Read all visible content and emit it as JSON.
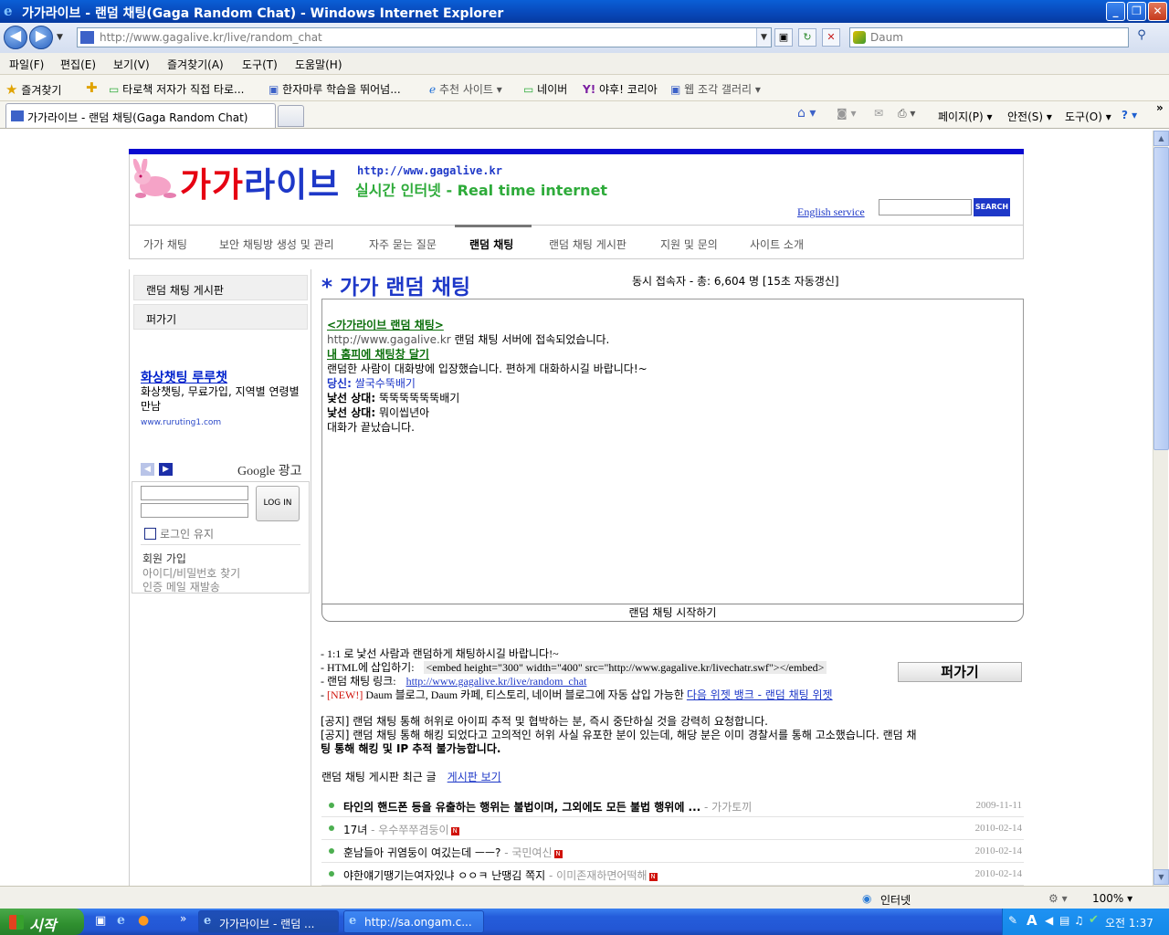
{
  "window": {
    "title": "가가라이브 - 랜덤 채팅(Gaga Random Chat) - Windows Internet Explorer",
    "minimize": "_",
    "maximize": "❐",
    "close": "✕"
  },
  "address": {
    "url": "http://www.gagalive.kr/live/random_chat",
    "search_placeholder": "Daum"
  },
  "menu": [
    "파일(F)",
    "편집(E)",
    "보기(V)",
    "즐겨찾기(A)",
    "도구(T)",
    "도움말(H)"
  ],
  "favorites": {
    "label": "즐겨찾기",
    "items": [
      "타로책 저자가 직접 타로...",
      "한자마루 학습을 뛰어넘...",
      "추천 사이트 ▾",
      "네이버",
      "야후! 코리아",
      "웹 조각 갤러리 ▾"
    ]
  },
  "tab": {
    "label": "가가라이브 - 랜덤 채팅(Gaga Random Chat)"
  },
  "commandbar": [
    "페이지(P) ▾",
    "안전(S) ▾",
    "도구(O) ▾"
  ],
  "header": {
    "logo_red": "가가",
    "logo_blue": "라이브",
    "site_url": "http://www.gagalive.kr",
    "slogan": "실시간 인터넷 - Real time internet",
    "english_service": "English service",
    "search_button": "SEARCH"
  },
  "nav": [
    "가가 채팅",
    "보안 채팅방 생성 및 관리",
    "자주 묻는 질문",
    "랜덤 채팅",
    "랜덤 채팅 게시판",
    "지원 및 문의",
    "사이트 소개"
  ],
  "sidebar": {
    "items": [
      "랜덤 채팅 게시판",
      "퍼가기"
    ],
    "ad": {
      "title": "화상챗팅 루루챗",
      "desc": "화상챗팅, 무료가입, 지역별 연령별 만남",
      "url": "www.ruruting1.com",
      "prev": "◀",
      "next": "▶",
      "google": "Google 광고"
    },
    "login": {
      "button": "LOG IN",
      "keep": "로그인 유지",
      "join": "회원 가입",
      "find": "아이디/비밀번호 찾기",
      "resend": "인증 메일 재발송"
    }
  },
  "main": {
    "title": "* 가가 랜덤 채팅",
    "online": "동시 접속자 - 총: 6,604 명 [15초 자동갱신]",
    "chat": {
      "header_link": "<가가라이브 랜덤 채팅>",
      "connected_url": "http://www.gagalive.kr",
      "connected_text": " 랜덤 채팅 서버에 접속되었습니다.",
      "embed_link": " 내 홈피에 채팅창 달기",
      "entered": "랜덤한 사람이 대화방에 입장했습니다. 편하게 대화하시길 바랍니다!~",
      "you_label": "당신:",
      "you_msg": " 쌀국수뚝배기",
      "stranger_label": "낯선 상대:",
      "stranger_msg1": " 뚝뚝뚝뚝뚝뚝배기",
      "stranger_msg2": " 뭐이씹년아",
      "ended": "대화가 끝났습니다."
    },
    "start_button": "랜덤 채팅 시작하기",
    "info": {
      "line1": "- 1:1 로 낯선 사람과 랜덤하게 채팅하시길 바랍니다!~",
      "line2_label": "- HTML에 삽입하기:",
      "line2_code": "<embed height=\"300\" width=\"400\" src=\"http://www.gagalive.kr/livechatr.swf\"></embed>",
      "line3_label": "- 랜덤 채팅 링크:",
      "line3_link": "http://www.gagalive.kr/live/random_chat",
      "line4_prefix": "- ",
      "line4_new": "[NEW!]",
      "line4_text": " Daum 블로그, Daum 카페, 티스토리, 네이버 블로그에 자동 삽입 가능한 ",
      "line4_link": "다음 위젯 뱅크 - 랜덤 채팅 위젯"
    },
    "scrap_button": "퍼가기",
    "notices": [
      "[공지] 랜덤 채팅 통해 허위로 아이피 추적 및 협박하는 분, 즉시 중단하실 것을 강력히 요청합니다.",
      "[공지] 랜덤 채팅 통해 해킹 되었다고 고의적인 허위 사실 유포한 분이 있는데, 해당 분은 이미 경찰서를 통해 고소했습니다. 랜덤 채",
      "팅 통해 해킹 및 IP 추적 불가능합니다."
    ],
    "board": {
      "label": "랜덤 채팅 게시판 최근 글",
      "link": "게시판 보기",
      "rows": [
        {
          "subject": "타인의 핸드폰 등을 유출하는 행위는 불법이며, 그외에도 모든 불법 행위에 ...",
          "author": " - 가가토끼",
          "date": "2009-11-11",
          "new": ""
        },
        {
          "subject": "17녀",
          "author": " - 우수쭈쭈겸둥이",
          "date": "2010-02-14",
          "new": "N"
        },
        {
          "subject": "훈남들아 귀염둥이 여깄는데 ㅡㅡ?",
          "author": " - 국민여신",
          "date": "2010-02-14",
          "new": "N"
        },
        {
          "subject": "야한얘기땡기는여자있냐 ㅇㅇㅋ 난땡김 쪽지",
          "author": " - 이미존재하면어떡해",
          "date": "2010-02-14",
          "new": "N"
        }
      ]
    }
  },
  "status": {
    "zone": "인터넷",
    "zoom": "100% ▾"
  },
  "taskbar": {
    "start": "시작",
    "tasks": [
      "가가라이브 - 랜덤 ...",
      "http://sa.ongam.c..."
    ],
    "clock": "오전 1:37"
  },
  "colors": {
    "brand_red": "#e60012",
    "brand_blue": "#1e38c8",
    "slogan_green": "#2eab3a"
  }
}
